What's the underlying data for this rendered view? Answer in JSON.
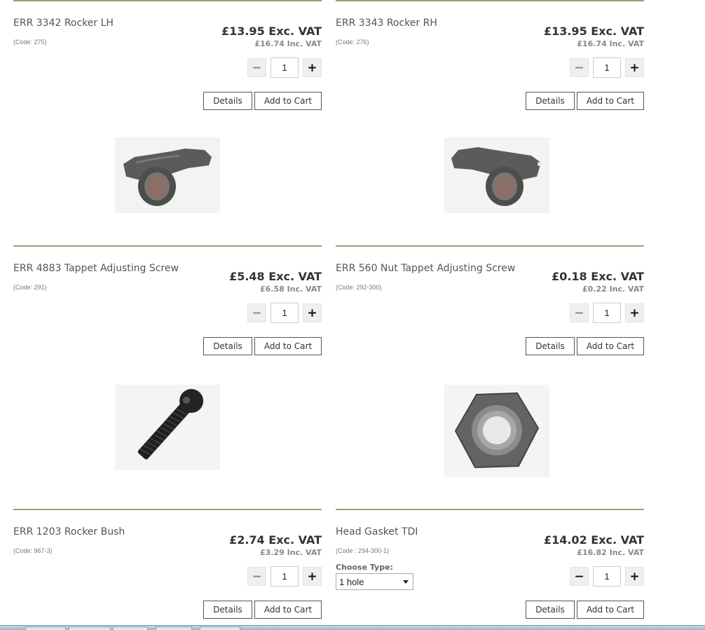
{
  "products": [
    {
      "title": "ERR 3342 Rocker LH",
      "code": "(Code: 275)",
      "price_ex": "£13.95 Exc. VAT",
      "price_inc": "£16.74 Inc. VAT",
      "qty": "1",
      "details_label": "Details",
      "cart_label": "Add to Cart",
      "image": "rocker-lh-photo"
    },
    {
      "title": "ERR 3343 Rocker RH",
      "code": "(Code: 276)",
      "price_ex": "£13.95 Exc. VAT",
      "price_inc": "£16.74 Inc. VAT",
      "qty": "1",
      "details_label": "Details",
      "cart_label": "Add to Cart",
      "image": "rocker-rh-photo"
    },
    {
      "title": "ERR 4883 Tappet Adjusting Screw",
      "code": "(Code: 291)",
      "price_ex": "£5.48 Exc. VAT",
      "price_inc": "£6.58 Inc. VAT",
      "qty": "1",
      "details_label": "Details",
      "cart_label": "Add to Cart",
      "image": "tappet-screw-photo"
    },
    {
      "title": "ERR 560 Nut Tappet Adjusting Screw",
      "code": "(Code: 292-300)",
      "price_ex": "£0.18 Exc. VAT",
      "price_inc": "£0.22 Inc. VAT",
      "qty": "1",
      "details_label": "Details",
      "cart_label": "Add to Cart",
      "image": "hex-nut-photo"
    },
    {
      "title": "ERR 1203 Rocker Bush",
      "code": "(Code: 967-3)",
      "price_ex": "£2.74 Exc. VAT",
      "price_inc": "£3.29 Inc. VAT",
      "qty": "1",
      "details_label": "Details",
      "cart_label": "Add to Cart"
    },
    {
      "title": "Head Gasket TDI",
      "code": "(Code : 294-300-1)",
      "price_ex": "£14.02 Exc. VAT",
      "price_inc": "£16.82 Inc. VAT",
      "qty": "1",
      "details_label": "Details",
      "cart_label": "Add to Cart",
      "choose_label": "Choose Type:",
      "choose_value": "1 hole"
    }
  ],
  "icons": {
    "minus": "minus-icon",
    "plus": "plus-icon",
    "dropdown": "chevron-down-icon"
  },
  "colors": {
    "rule": "#a09a7c",
    "button_border": "#555555"
  }
}
